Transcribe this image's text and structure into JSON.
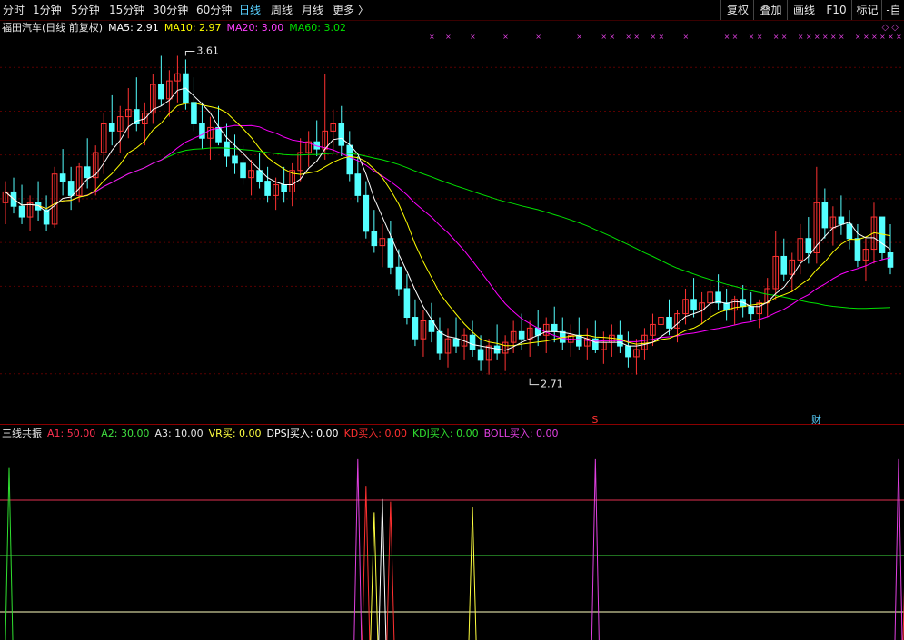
{
  "toolbar": {
    "periods": [
      "分时",
      "1分钟",
      "5分钟",
      "15分钟",
      "30分钟",
      "60分钟",
      "日线",
      "周线",
      "月线",
      "更多 〉"
    ],
    "active_index": 6,
    "right_buttons": [
      "复权",
      "叠加",
      "画线",
      "F10",
      "标记",
      "-自"
    ]
  },
  "main_legend": {
    "title": "福田汽车(日线 前复权)",
    "ma5": "MA5: 2.91",
    "ma10": "MA10: 2.97",
    "ma20": "MA20: 3.00",
    "ma60": "MA60: 3.02"
  },
  "sub_legend": {
    "title": "三线共振",
    "a1": "A1: 50.00",
    "a2": "A2: 30.00",
    "a3": "A3: 10.00",
    "vr": "VR买: 0.00",
    "dpsj": "DPSJ买入: 0.00",
    "kd": "KD买入: 0.00",
    "kdj": "KDJ买入: 0.00",
    "boll": "BOLL买入: 0.00"
  },
  "markers": {
    "high_label": "3.61",
    "low_label": "2.71",
    "s_marker": "S",
    "cai_marker": "财"
  },
  "colors": {
    "up": "#ff3232",
    "down": "#54ffff",
    "ma5": "#ffffff",
    "ma10": "#ffff00",
    "ma20": "#ff00ff",
    "ma60": "#00e000",
    "grid": "#5a0000",
    "a1_line": "#e03050",
    "a2_line": "#40e040",
    "a3_line": "#ffffc0",
    "vr": "#ffff40",
    "dpsj": "#ffffff",
    "kd": "#ff3030",
    "kdj": "#30e030",
    "boll": "#e040e0"
  },
  "chart_data": [
    {
      "type": "candlestick",
      "title": "福田汽车(日线 前复权)",
      "ylim": [
        2.6,
        3.7
      ],
      "annotations": [
        {
          "text": "3.61",
          "x": 22,
          "y": 3.61
        },
        {
          "text": "2.71",
          "x": 64,
          "y": 2.71
        }
      ],
      "candles": [
        [
          3.2,
          3.26,
          3.14,
          3.23
        ],
        [
          3.23,
          3.27,
          3.17,
          3.19
        ],
        [
          3.19,
          3.25,
          3.14,
          3.16
        ],
        [
          3.16,
          3.22,
          3.12,
          3.2
        ],
        [
          3.2,
          3.26,
          3.15,
          3.18
        ],
        [
          3.18,
          3.22,
          3.12,
          3.14
        ],
        [
          3.14,
          3.3,
          3.13,
          3.28
        ],
        [
          3.28,
          3.35,
          3.22,
          3.26
        ],
        [
          3.26,
          3.3,
          3.18,
          3.22
        ],
        [
          3.22,
          3.31,
          3.2,
          3.3
        ],
        [
          3.3,
          3.38,
          3.24,
          3.27
        ],
        [
          3.27,
          3.36,
          3.22,
          3.34
        ],
        [
          3.34,
          3.45,
          3.28,
          3.42
        ],
        [
          3.42,
          3.5,
          3.36,
          3.4
        ],
        [
          3.4,
          3.47,
          3.34,
          3.44
        ],
        [
          3.44,
          3.52,
          3.38,
          3.46
        ],
        [
          3.46,
          3.55,
          3.4,
          3.42
        ],
        [
          3.42,
          3.48,
          3.36,
          3.45
        ],
        [
          3.45,
          3.56,
          3.42,
          3.53
        ],
        [
          3.53,
          3.61,
          3.47,
          3.49
        ],
        [
          3.49,
          3.57,
          3.44,
          3.54
        ],
        [
          3.54,
          3.61,
          3.48,
          3.56
        ],
        [
          3.56,
          3.6,
          3.46,
          3.48
        ],
        [
          3.48,
          3.55,
          3.4,
          3.42
        ],
        [
          3.42,
          3.48,
          3.35,
          3.38
        ],
        [
          3.38,
          3.44,
          3.32,
          3.41
        ],
        [
          3.41,
          3.47,
          3.36,
          3.37
        ],
        [
          3.37,
          3.42,
          3.3,
          3.33
        ],
        [
          3.33,
          3.39,
          3.28,
          3.31
        ],
        [
          3.31,
          3.36,
          3.25,
          3.27
        ],
        [
          3.27,
          3.32,
          3.22,
          3.29
        ],
        [
          3.29,
          3.34,
          3.24,
          3.26
        ],
        [
          3.26,
          3.3,
          3.2,
          3.22
        ],
        [
          3.22,
          3.27,
          3.18,
          3.25
        ],
        [
          3.25,
          3.3,
          3.2,
          3.23
        ],
        [
          3.23,
          3.31,
          3.19,
          3.29
        ],
        [
          3.29,
          3.38,
          3.26,
          3.34
        ],
        [
          3.34,
          3.4,
          3.3,
          3.37
        ],
        [
          3.37,
          3.43,
          3.33,
          3.35
        ],
        [
          3.35,
          3.56,
          3.32,
          3.4
        ],
        [
          3.4,
          3.46,
          3.34,
          3.42
        ],
        [
          3.42,
          3.47,
          3.33,
          3.36
        ],
        [
          3.36,
          3.4,
          3.26,
          3.28
        ],
        [
          3.28,
          3.33,
          3.2,
          3.22
        ],
        [
          3.22,
          3.26,
          3.1,
          3.12
        ],
        [
          3.12,
          3.18,
          3.06,
          3.08
        ],
        [
          3.08,
          3.14,
          3.02,
          3.1
        ],
        [
          3.1,
          3.15,
          3.0,
          3.02
        ],
        [
          3.02,
          3.07,
          2.94,
          2.96
        ],
        [
          2.96,
          3.0,
          2.86,
          2.88
        ],
        [
          2.88,
          2.93,
          2.8,
          2.82
        ],
        [
          2.82,
          2.9,
          2.77,
          2.87
        ],
        [
          2.87,
          2.92,
          2.81,
          2.84
        ],
        [
          2.84,
          2.88,
          2.76,
          2.78
        ],
        [
          2.78,
          2.85,
          2.74,
          2.82
        ],
        [
          2.82,
          2.88,
          2.78,
          2.8
        ],
        [
          2.8,
          2.85,
          2.76,
          2.83
        ],
        [
          2.83,
          2.87,
          2.77,
          2.79
        ],
        [
          2.79,
          2.83,
          2.73,
          2.76
        ],
        [
          2.76,
          2.82,
          2.72,
          2.8
        ],
        [
          2.8,
          2.86,
          2.76,
          2.78
        ],
        [
          2.78,
          2.83,
          2.73,
          2.81
        ],
        [
          2.81,
          2.87,
          2.78,
          2.84
        ],
        [
          2.84,
          2.89,
          2.79,
          2.82
        ],
        [
          2.82,
          2.87,
          2.77,
          2.85
        ],
        [
          2.85,
          2.9,
          2.8,
          2.83
        ],
        [
          2.83,
          2.88,
          2.78,
          2.86
        ],
        [
          2.86,
          2.91,
          2.81,
          2.84
        ],
        [
          2.84,
          2.88,
          2.79,
          2.81
        ],
        [
          2.81,
          2.86,
          2.77,
          2.83
        ],
        [
          2.83,
          2.88,
          2.79,
          2.8
        ],
        [
          2.8,
          2.85,
          2.76,
          2.82
        ],
        [
          2.82,
          2.87,
          2.78,
          2.79
        ],
        [
          2.79,
          2.84,
          2.75,
          2.81
        ],
        [
          2.81,
          2.86,
          2.77,
          2.83
        ],
        [
          2.83,
          2.87,
          2.78,
          2.8
        ],
        [
          2.8,
          2.84,
          2.74,
          2.77
        ],
        [
          2.77,
          2.82,
          2.72,
          2.79
        ],
        [
          2.79,
          2.85,
          2.76,
          2.83
        ],
        [
          2.83,
          2.89,
          2.8,
          2.86
        ],
        [
          2.86,
          2.91,
          2.82,
          2.88
        ],
        [
          2.88,
          2.93,
          2.83,
          2.85
        ],
        [
          2.85,
          2.9,
          2.81,
          2.89
        ],
        [
          2.89,
          2.96,
          2.86,
          2.93
        ],
        [
          2.93,
          2.99,
          2.88,
          2.9
        ],
        [
          2.9,
          2.95,
          2.86,
          2.92
        ],
        [
          2.92,
          2.98,
          2.88,
          2.95
        ],
        [
          2.95,
          3.0,
          2.9,
          2.92
        ],
        [
          2.92,
          2.96,
          2.87,
          2.9
        ],
        [
          2.9,
          2.94,
          2.86,
          2.93
        ],
        [
          2.93,
          2.97,
          2.88,
          2.91
        ],
        [
          2.91,
          2.95,
          2.87,
          2.89
        ],
        [
          2.89,
          2.93,
          2.85,
          2.92
        ],
        [
          2.92,
          2.99,
          2.88,
          2.96
        ],
        [
          2.96,
          3.12,
          2.93,
          3.05
        ],
        [
          3.05,
          3.1,
          2.98,
          3.0
        ],
        [
          3.0,
          3.06,
          2.95,
          3.04
        ],
        [
          3.04,
          3.14,
          3.0,
          3.1
        ],
        [
          3.1,
          3.16,
          3.03,
          3.06
        ],
        [
          3.06,
          3.3,
          3.03,
          3.2
        ],
        [
          3.2,
          3.24,
          3.1,
          3.13
        ],
        [
          3.13,
          3.19,
          3.08,
          3.16
        ],
        [
          3.16,
          3.22,
          3.11,
          3.14
        ],
        [
          3.14,
          3.18,
          3.07,
          3.1
        ],
        [
          3.1,
          3.14,
          3.02,
          3.04
        ],
        [
          3.04,
          3.1,
          2.98,
          3.07
        ],
        [
          3.07,
          3.2,
          3.03,
          3.16
        ],
        [
          3.16,
          3.14,
          3.04,
          3.06
        ],
        [
          3.06,
          3.14,
          3.0,
          3.02
        ]
      ],
      "series": [
        {
          "name": "MA5",
          "value": 2.91
        },
        {
          "name": "MA10",
          "value": 2.97
        },
        {
          "name": "MA20",
          "value": 3.0
        },
        {
          "name": "MA60",
          "value": 3.02
        }
      ]
    },
    {
      "type": "line",
      "title": "三线共振",
      "ylim": [
        0,
        60
      ],
      "hlines": [
        {
          "name": "A1",
          "value": 50
        },
        {
          "name": "A2",
          "value": 30
        },
        {
          "name": "A3",
          "value": 10
        }
      ],
      "spikes": [
        {
          "name": "KDJ买入",
          "x": 0,
          "value": 65
        },
        {
          "name": "BOLL买入",
          "x": 43,
          "value": 68
        },
        {
          "name": "KD买入",
          "x": 44,
          "value": 58
        },
        {
          "name": "VR买",
          "x": 45,
          "value": 48
        },
        {
          "name": "DPSJ买入",
          "x": 46,
          "value": 53
        },
        {
          "name": "KD买入",
          "x": 47,
          "value": 52
        },
        {
          "name": "VR买",
          "x": 57,
          "value": 50
        },
        {
          "name": "BOLL买入",
          "x": 72,
          "value": 68
        },
        {
          "name": "BOLL买入",
          "x": 109,
          "value": 68
        },
        {
          "name": "KD买入",
          "x": 110,
          "value": 54
        }
      ]
    }
  ]
}
